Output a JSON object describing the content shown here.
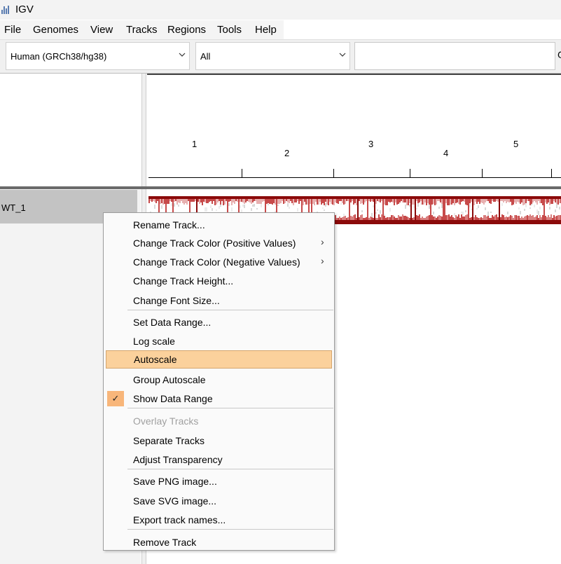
{
  "window": {
    "title": "IGV"
  },
  "menubar": [
    "File",
    "Genomes",
    "View",
    "Tracks",
    "Regions",
    "Tools",
    "Help"
  ],
  "toolbar": {
    "genome_value": "Human (GRCh38/hg38)",
    "chromosome_value": "All",
    "locus_value": "",
    "cut_glyph": "G"
  },
  "ruler": {
    "chromosomes": [
      "1",
      "2",
      "3",
      "4",
      "5"
    ]
  },
  "track": {
    "name": "WT_1"
  },
  "context_menu": {
    "items": [
      "Rename Track...",
      "Change Track Color (Positive Values)",
      "Change Track Color (Negative Values)",
      "Change Track Height...",
      "Change Font Size...",
      "Set Data Range...",
      "Log scale",
      "Autoscale",
      "Group Autoscale",
      "Show Data Range",
      "Overlay Tracks",
      "Separate Tracks",
      "Adjust Transparency",
      "Save PNG image...",
      "Save SVG image...",
      "Export track names...",
      "Remove Track"
    ],
    "submenu_glyph": "›",
    "check_glyph": "✓",
    "highlighted": "Autoscale",
    "checked": "Show Data Range",
    "disabled": "Overlay Tracks"
  },
  "colors": {
    "heatmap_dark": "#8b0a0a",
    "heatmap_mid": "#c74a4a",
    "highlight": "#fbd19c",
    "check_bg": "#f8b67a"
  },
  "icons": [
    "igv-app-icon",
    "chevron-down-icon",
    "chevron-right-icon",
    "checkmark-icon"
  ]
}
